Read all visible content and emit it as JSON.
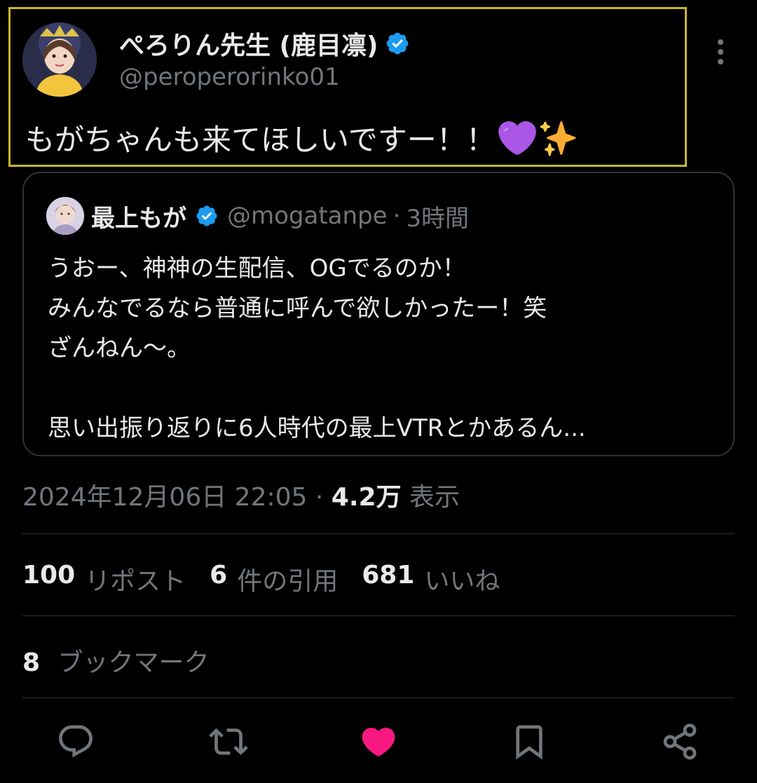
{
  "tweet": {
    "author": {
      "display_name": "ぺろりん先生 (鹿目凛)",
      "handle": "@peroperorinko01",
      "verified": true
    },
    "text": "もがちゃんも来てほしいですー！！",
    "emojis": [
      "purple-heart",
      "sparkles"
    ]
  },
  "quote": {
    "author": {
      "display_name": "最上もが",
      "handle": "@mogatanpe",
      "separator": "·",
      "time": "3時間",
      "verified": true
    },
    "body": "うおー、神神の生配信、OGでるのか！\nみんなでるなら普通に呼んで欲しかったー！笑\nざんねん〜。\n\n思い出振り返りに6人時代の最上VTRとかあるん..."
  },
  "meta": {
    "timestamp": "2024年12月06日 22:05",
    "separator": "·",
    "views_count": "4.2万",
    "views_label": "表示"
  },
  "stats": {
    "reposts_count": "100",
    "reposts_label": "リポスト",
    "quotes_count": "6",
    "quotes_label": "件の引用",
    "likes_count": "681",
    "likes_label": "いいね",
    "bookmarks_count": "8",
    "bookmarks_label": "ブックマーク"
  },
  "actions": {
    "icons": [
      "reply-icon",
      "retweet-icon",
      "like-icon",
      "bookmark-icon",
      "share-icon"
    ],
    "liked": true
  },
  "colors": {
    "background": "#000000",
    "text_primary": "#e7e9ea",
    "text_secondary": "#71767b",
    "border": "#2f3336",
    "verified_blue": "#1d9bf0",
    "like_pink": "#f91880",
    "highlight_box": "#c9b52a"
  }
}
